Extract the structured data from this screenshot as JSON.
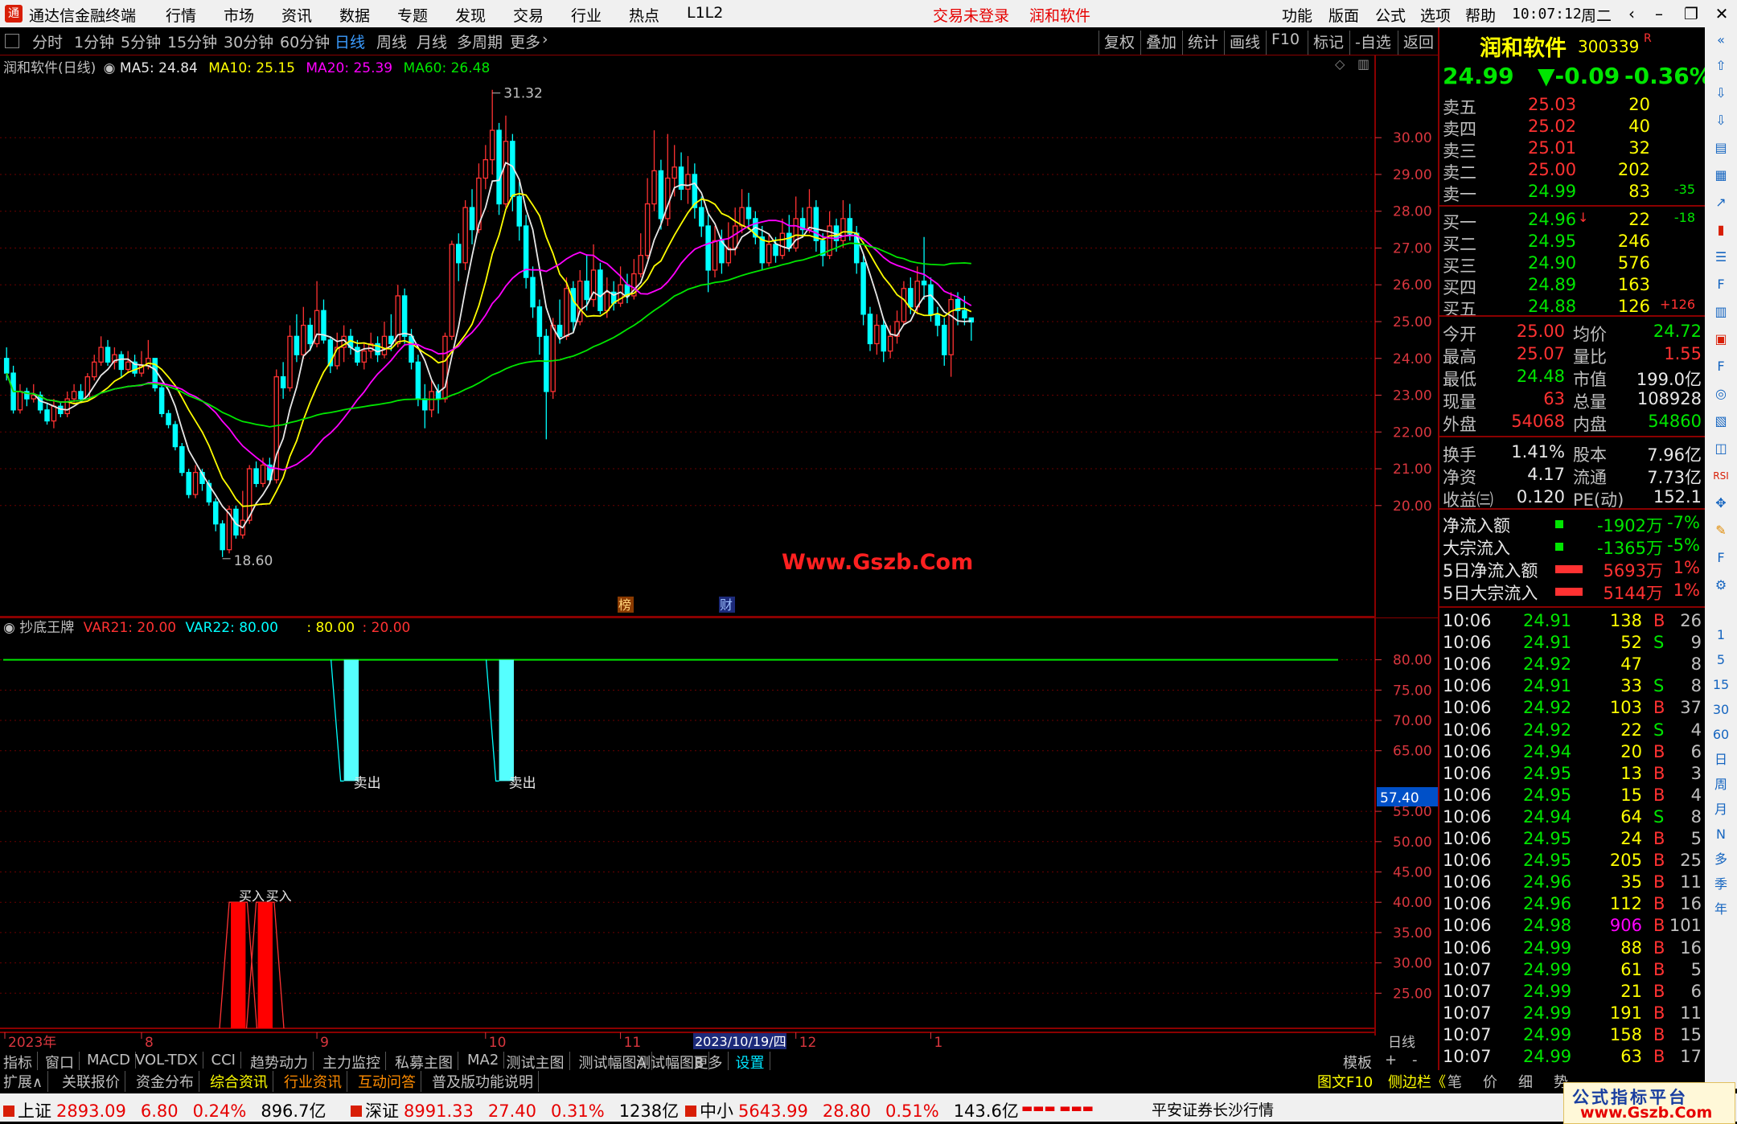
{
  "titlebar": {
    "app_title": "通达信金融终端",
    "menus": [
      "行情",
      "市场",
      "资讯",
      "数据",
      "专题",
      "发现",
      "交易",
      "行业",
      "热点",
      "L1L2"
    ],
    "login_status": "交易未登录",
    "stock_name": "润和软件",
    "right_menus": [
      "功能",
      "版面",
      "公式",
      "选项",
      "帮助"
    ],
    "time": "10:07:12",
    "weekday": "周二"
  },
  "toolbar": {
    "periods": [
      "分时",
      "1分钟",
      "5分钟",
      "15分钟",
      "30分钟",
      "60分钟",
      "日线",
      "周线",
      "月线",
      "多周期",
      "更多"
    ],
    "active": "日线",
    "right_buttons": [
      "复权",
      "叠加",
      "统计",
      "画线",
      "F10",
      "标记",
      "-自选",
      "返回"
    ]
  },
  "chart": {
    "title": "润和软件(日线)",
    "ma": [
      {
        "label": "MA5: 24.84",
        "color": "#e8e8e8"
      },
      {
        "label": "MA10: 25.15",
        "color": "#ffff00"
      },
      {
        "label": "MA20: 25.39",
        "color": "#ff00ff"
      },
      {
        "label": "MA60: 26.48",
        "color": "#00e600"
      }
    ],
    "y_ticks": [
      "30.00",
      "29.00",
      "28.00",
      "27.00",
      "26.00",
      "25.00",
      "24.00",
      "23.00",
      "22.00",
      "21.00",
      "20.00"
    ],
    "high_label": "31.32",
    "low_label": "18.60",
    "watermark": "Www.Gszb.Com",
    "markers": [
      "榜",
      "财"
    ]
  },
  "indicator": {
    "name": "抄底王牌",
    "var21": "VAR21: 20.00",
    "var22": "VAR22: 80.00",
    "lvl1": ": 80.00",
    "lvl2": ": 20.00",
    "y_ticks": [
      "80.00",
      "75.00",
      "70.00",
      "65.00",
      "55.00",
      "50.00",
      "45.00",
      "40.00",
      "35.00",
      "30.00",
      "25.00"
    ],
    "current": "57.40",
    "sell_label": "卖出",
    "buy_label": "买入"
  },
  "x_axis": {
    "labels": [
      "2023年",
      "8",
      "9",
      "10",
      "11",
      "12",
      "1"
    ],
    "cursor_date": "2023/10/19/四",
    "period": "日线"
  },
  "quote": {
    "name": "润和软件",
    "code": "300339",
    "flag": "R",
    "price": "24.99",
    "change": "▼-0.09",
    "pct": "-0.36%",
    "asks": [
      {
        "label": "卖五",
        "price": "25.03",
        "vol": "20",
        "chg": ""
      },
      {
        "label": "卖四",
        "price": "25.02",
        "vol": "40",
        "chg": ""
      },
      {
        "label": "卖三",
        "price": "25.01",
        "vol": "32",
        "chg": ""
      },
      {
        "label": "卖二",
        "price": "25.00",
        "vol": "202",
        "chg": ""
      },
      {
        "label": "卖一",
        "price": "24.99",
        "vol": "83",
        "chg": "-35"
      }
    ],
    "bids": [
      {
        "label": "买一",
        "price": "24.96",
        "arrow": "↓",
        "vol": "22",
        "chg": "-18"
      },
      {
        "label": "买二",
        "price": "24.95",
        "arrow": "",
        "vol": "246",
        "chg": ""
      },
      {
        "label": "买三",
        "price": "24.90",
        "arrow": "",
        "vol": "576",
        "chg": ""
      },
      {
        "label": "买四",
        "price": "24.89",
        "arrow": "",
        "vol": "163",
        "chg": ""
      },
      {
        "label": "买五",
        "price": "24.88",
        "arrow": "",
        "vol": "126",
        "chg": "+126"
      }
    ],
    "stats": [
      {
        "k1": "今开",
        "v1": "25.00",
        "k2": "均价",
        "v2": "24.72",
        "c1": "red",
        "c2": "green"
      },
      {
        "k1": "最高",
        "v1": "25.07",
        "k2": "量比",
        "v2": "1.55",
        "c1": "red",
        "c2": "red"
      },
      {
        "k1": "最低",
        "v1": "24.48",
        "k2": "市值",
        "v2": "199.0亿",
        "c1": "green",
        "c2": "white"
      },
      {
        "k1": "现量",
        "v1": "63",
        "k2": "总量",
        "v2": "108928",
        "c1": "red",
        "c2": "white"
      },
      {
        "k1": "外盘",
        "v1": "54068",
        "k2": "内盘",
        "v2": "54860",
        "c1": "red",
        "c2": "green"
      }
    ],
    "stats2": [
      {
        "k1": "换手",
        "v1": "1.41%",
        "k2": "股本",
        "v2": "7.96亿"
      },
      {
        "k1": "净资",
        "v1": "4.17",
        "k2": "流通",
        "v2": "7.73亿"
      },
      {
        "k1": "收益㈢",
        "v1": "0.120",
        "k2": "PE(动)",
        "v2": "152.1"
      }
    ],
    "flows": [
      {
        "label": "净流入额",
        "val": "-1902万",
        "pct": "-7%",
        "color": "green"
      },
      {
        "label": "大宗流入",
        "val": "-1365万",
        "pct": "-5%",
        "color": "green"
      },
      {
        "label": "5日净流入额",
        "val": "5693万",
        "pct": "1%",
        "color": "red"
      },
      {
        "label": "5日大宗流入",
        "val": "5144万",
        "pct": "1%",
        "color": "red"
      }
    ],
    "ticks": [
      {
        "t": "10:06",
        "p": "24.91",
        "v": "138",
        "s": "B",
        "n": "26"
      },
      {
        "t": "10:06",
        "p": "24.91",
        "v": "52",
        "s": "S",
        "n": "9"
      },
      {
        "t": "10:06",
        "p": "24.92",
        "v": "47",
        "s": "",
        "n": "8"
      },
      {
        "t": "10:06",
        "p": "24.91",
        "v": "33",
        "s": "S",
        "n": "8"
      },
      {
        "t": "10:06",
        "p": "24.92",
        "v": "103",
        "s": "B",
        "n": "37"
      },
      {
        "t": "10:06",
        "p": "24.92",
        "v": "22",
        "s": "S",
        "n": "4"
      },
      {
        "t": "10:06",
        "p": "24.94",
        "v": "20",
        "s": "B",
        "n": "6"
      },
      {
        "t": "10:06",
        "p": "24.95",
        "v": "13",
        "s": "B",
        "n": "3"
      },
      {
        "t": "10:06",
        "p": "24.95",
        "v": "15",
        "s": "B",
        "n": "4"
      },
      {
        "t": "10:06",
        "p": "24.94",
        "v": "64",
        "s": "S",
        "n": "8"
      },
      {
        "t": "10:06",
        "p": "24.95",
        "v": "24",
        "s": "B",
        "n": "5"
      },
      {
        "t": "10:06",
        "p": "24.95",
        "v": "205",
        "s": "B",
        "n": "25"
      },
      {
        "t": "10:06",
        "p": "24.96",
        "v": "35",
        "s": "B",
        "n": "11"
      },
      {
        "t": "10:06",
        "p": "24.96",
        "v": "112",
        "s": "B",
        "n": "16"
      },
      {
        "t": "10:06",
        "p": "24.98",
        "v": "906",
        "s": "B",
        "n": "101"
      },
      {
        "t": "10:06",
        "p": "24.99",
        "v": "88",
        "s": "B",
        "n": "16"
      },
      {
        "t": "10:07",
        "p": "24.99",
        "v": "61",
        "s": "B",
        "n": "5"
      },
      {
        "t": "10:07",
        "p": "24.99",
        "v": "21",
        "s": "B",
        "n": "6"
      },
      {
        "t": "10:07",
        "p": "24.99",
        "v": "191",
        "s": "B",
        "n": "11"
      },
      {
        "t": "10:07",
        "p": "24.99",
        "v": "158",
        "s": "B",
        "n": "15"
      },
      {
        "t": "10:07",
        "p": "24.99",
        "v": "63",
        "s": "B",
        "n": "17"
      }
    ]
  },
  "tabs1": [
    "指标",
    "窗口",
    "MACD",
    "VOL-TDX",
    "CCI",
    "趋势动力",
    "主力监控",
    "私募主图",
    "MA2",
    "测试主图",
    "测试幅图A",
    "测试幅图B",
    "更多",
    "设置"
  ],
  "tabs1_right": [
    "模板",
    "+",
    "-"
  ],
  "tabs2": [
    "扩展∧",
    "关联报价",
    "资金分布",
    "综合资讯",
    "行业资讯",
    "互动问答",
    "普及版功能说明"
  ],
  "tabs2_right": [
    "图文F10",
    "侧边栏《",
    "笔",
    "价",
    "细",
    "势"
  ],
  "iconbar": [
    "1",
    "5",
    "15",
    "30",
    "60",
    "日",
    "周",
    "月",
    "N",
    "多",
    "季",
    "年"
  ],
  "statusbar": {
    "items": [
      {
        "name": "上证",
        "v": "2893.09",
        "c": "6.80",
        "p": "0.24%",
        "a": "896.7亿"
      },
      {
        "name": "深证",
        "v": "8991.33",
        "c": "27.40",
        "p": "0.31%",
        "a": "1238亿"
      },
      {
        "name": "中小",
        "v": "5643.99",
        "c": "28.80",
        "p": "0.51%",
        "a": "143.6亿"
      }
    ],
    "broker": "平安证券长沙行情",
    "brand": "公式指标平台",
    "brand_url": "www.Gszb.Com"
  },
  "colors": {
    "up": "#ff3232",
    "down": "#00ffff",
    "ma5": "#e8e8e8",
    "ma10": "#ffff00",
    "ma20": "#ff00ff",
    "ma60": "#00e600"
  },
  "chart_data": {
    "type": "candlestick",
    "y_range": [
      18.4,
      31.6
    ],
    "candles": [
      [
        24.0,
        23.6,
        24.3,
        23.4
      ],
      [
        23.6,
        22.6,
        23.8,
        22.5
      ],
      [
        22.6,
        23.1,
        23.3,
        22.5
      ],
      [
        23.1,
        22.9,
        23.2,
        22.7
      ],
      [
        22.9,
        23.0,
        23.3,
        22.8
      ],
      [
        23.0,
        22.6,
        23.1,
        22.5
      ],
      [
        22.6,
        22.3,
        22.8,
        22.2
      ],
      [
        22.3,
        22.7,
        22.9,
        22.1
      ],
      [
        22.7,
        22.5,
        22.8,
        22.4
      ],
      [
        22.5,
        22.9,
        23.1,
        22.4
      ],
      [
        22.9,
        23.1,
        23.3,
        22.8
      ],
      [
        23.1,
        22.9,
        23.3,
        22.8
      ],
      [
        22.9,
        23.5,
        23.6,
        22.9
      ],
      [
        23.5,
        23.9,
        24.1,
        23.4
      ],
      [
        23.9,
        24.3,
        24.6,
        23.8
      ],
      [
        24.3,
        23.9,
        24.5,
        23.8
      ],
      [
        23.9,
        24.1,
        24.3,
        23.7
      ],
      [
        24.1,
        23.7,
        24.2,
        23.5
      ],
      [
        23.7,
        23.9,
        24.2,
        23.6
      ],
      [
        23.9,
        23.6,
        24.1,
        23.5
      ],
      [
        23.6,
        23.8,
        24.2,
        23.5
      ],
      [
        23.8,
        24.0,
        24.5,
        23.7
      ],
      [
        24.0,
        23.2,
        24.0,
        23.1
      ],
      [
        23.2,
        22.5,
        23.3,
        22.4
      ],
      [
        22.5,
        22.2,
        22.6,
        22.1
      ],
      [
        22.2,
        21.6,
        22.3,
        21.5
      ],
      [
        21.6,
        20.9,
        21.7,
        20.8
      ],
      [
        20.9,
        20.3,
        21.0,
        20.2
      ],
      [
        20.3,
        20.9,
        21.1,
        20.2
      ],
      [
        20.9,
        20.6,
        21.0,
        20.4
      ],
      [
        20.6,
        20.1,
        20.7,
        20.0
      ],
      [
        20.1,
        19.5,
        20.2,
        19.3
      ],
      [
        19.5,
        18.8,
        19.6,
        18.6
      ],
      [
        18.8,
        19.9,
        20.0,
        18.7
      ],
      [
        19.9,
        19.2,
        20.0,
        19.1
      ],
      [
        19.2,
        19.6,
        20.4,
        19.1
      ],
      [
        19.6,
        21.0,
        21.1,
        19.5
      ],
      [
        21.0,
        20.6,
        21.2,
        20.5
      ],
      [
        20.6,
        21.1,
        21.3,
        20.5
      ],
      [
        21.1,
        20.7,
        21.3,
        20.6
      ],
      [
        20.7,
        23.5,
        23.7,
        20.6
      ],
      [
        23.5,
        23.2,
        23.9,
        22.9
      ],
      [
        23.2,
        24.6,
        24.9,
        23.1
      ],
      [
        24.6,
        24.1,
        25.2,
        23.9
      ],
      [
        24.1,
        24.9,
        25.4,
        24.0
      ],
      [
        24.9,
        24.4,
        25.1,
        24.2
      ],
      [
        24.4,
        25.3,
        26.1,
        24.3
      ],
      [
        25.3,
        24.5,
        25.6,
        24.4
      ],
      [
        24.5,
        23.8,
        24.6,
        23.6
      ],
      [
        23.8,
        24.3,
        24.7,
        23.7
      ],
      [
        24.3,
        24.6,
        24.9,
        23.9
      ],
      [
        24.6,
        24.3,
        24.8,
        24.1
      ],
      [
        24.3,
        23.9,
        24.5,
        23.8
      ],
      [
        23.9,
        24.2,
        24.4,
        23.7
      ],
      [
        24.2,
        24.4,
        24.7,
        24.0
      ],
      [
        24.4,
        24.1,
        24.6,
        23.9
      ],
      [
        24.1,
        24.6,
        25.0,
        24.0
      ],
      [
        24.6,
        24.4,
        25.2,
        24.2
      ],
      [
        24.4,
        25.7,
        26.0,
        24.3
      ],
      [
        25.7,
        24.6,
        25.9,
        24.4
      ],
      [
        24.6,
        23.9,
        24.8,
        23.7
      ],
      [
        23.9,
        22.9,
        24.1,
        22.7
      ],
      [
        22.9,
        22.6,
        23.3,
        22.1
      ],
      [
        22.6,
        23.1,
        23.4,
        22.4
      ],
      [
        23.1,
        22.9,
        23.3,
        22.5
      ],
      [
        22.9,
        24.6,
        24.7,
        22.8
      ],
      [
        24.6,
        27.1,
        27.2,
        24.5
      ],
      [
        27.1,
        26.6,
        27.4,
        26.1
      ],
      [
        26.6,
        28.1,
        28.3,
        26.4
      ],
      [
        28.1,
        27.5,
        28.6,
        27.1
      ],
      [
        27.5,
        28.9,
        29.3,
        27.4
      ],
      [
        28.9,
        29.4,
        29.8,
        28.6
      ],
      [
        29.4,
        30.2,
        31.3,
        29.0
      ],
      [
        30.2,
        28.2,
        30.4,
        27.9
      ],
      [
        28.2,
        29.9,
        30.6,
        28.1
      ],
      [
        29.9,
        28.4,
        30.1,
        28.0
      ],
      [
        28.4,
        27.6,
        28.8,
        27.2
      ],
      [
        27.6,
        26.2,
        27.9,
        25.9
      ],
      [
        26.2,
        25.4,
        26.5,
        25.1
      ],
      [
        25.4,
        24.6,
        25.6,
        24.1
      ],
      [
        24.6,
        23.1,
        24.8,
        21.8
      ],
      [
        23.1,
        24.9,
        25.1,
        22.9
      ],
      [
        24.9,
        24.6,
        25.6,
        24.4
      ],
      [
        24.6,
        25.9,
        26.2,
        24.5
      ],
      [
        25.9,
        25.0,
        26.1,
        24.7
      ],
      [
        25.0,
        26.1,
        26.4,
        24.9
      ],
      [
        26.1,
        25.6,
        26.8,
        25.3
      ],
      [
        25.6,
        26.4,
        27.1,
        25.4
      ],
      [
        26.4,
        25.3,
        26.6,
        25.2
      ],
      [
        25.3,
        25.8,
        26.2,
        25.1
      ],
      [
        25.8,
        25.5,
        26.1,
        25.3
      ],
      [
        25.5,
        26.0,
        26.5,
        25.4
      ],
      [
        26.0,
        25.7,
        26.3,
        25.5
      ],
      [
        25.7,
        26.3,
        26.7,
        25.6
      ],
      [
        26.3,
        26.8,
        27.4,
        26.2
      ],
      [
        26.8,
        28.2,
        28.9,
        26.7
      ],
      [
        28.2,
        29.1,
        30.2,
        28.0
      ],
      [
        29.1,
        27.8,
        29.4,
        27.5
      ],
      [
        27.8,
        28.9,
        30.1,
        27.6
      ],
      [
        28.9,
        29.2,
        29.8,
        28.4
      ],
      [
        29.2,
        28.6,
        29.6,
        28.3
      ],
      [
        28.6,
        29.0,
        29.5,
        28.2
      ],
      [
        29.0,
        28.1,
        29.3,
        27.8
      ],
      [
        28.1,
        27.6,
        28.4,
        27.3
      ],
      [
        27.6,
        26.4,
        27.9,
        25.8
      ],
      [
        26.4,
        27.2,
        27.6,
        26.2
      ],
      [
        27.2,
        26.6,
        27.5,
        26.3
      ],
      [
        26.6,
        27.0,
        27.7,
        26.5
      ],
      [
        27.0,
        27.6,
        28.1,
        26.8
      ],
      [
        27.6,
        28.1,
        28.6,
        27.4
      ],
      [
        28.1,
        27.8,
        28.5,
        27.5
      ],
      [
        27.8,
        27.3,
        28.0,
        27.1
      ],
      [
        27.3,
        26.6,
        27.6,
        26.4
      ],
      [
        26.6,
        27.1,
        27.4,
        26.5
      ],
      [
        27.1,
        26.8,
        27.3,
        26.6
      ],
      [
        26.8,
        27.4,
        27.8,
        26.7
      ],
      [
        27.4,
        27.0,
        27.9,
        26.9
      ],
      [
        27.0,
        27.8,
        28.4,
        26.9
      ],
      [
        27.8,
        27.5,
        28.1,
        27.3
      ],
      [
        27.5,
        28.1,
        28.6,
        27.4
      ],
      [
        28.1,
        27.2,
        28.3,
        26.9
      ],
      [
        27.2,
        26.8,
        27.4,
        26.5
      ],
      [
        26.8,
        27.6,
        28.0,
        26.7
      ],
      [
        27.6,
        27.2,
        27.8,
        26.9
      ],
      [
        27.2,
        27.8,
        28.3,
        27.0
      ],
      [
        27.8,
        27.4,
        28.2,
        27.2
      ],
      [
        27.4,
        26.6,
        27.6,
        26.3
      ],
      [
        26.6,
        25.2,
        26.8,
        24.9
      ],
      [
        25.2,
        24.4,
        25.4,
        24.2
      ],
      [
        24.4,
        24.9,
        25.2,
        24.1
      ],
      [
        24.9,
        24.2,
        25.1,
        23.9
      ],
      [
        24.2,
        24.6,
        24.9,
        24.0
      ],
      [
        24.6,
        25.0,
        25.3,
        24.4
      ],
      [
        25.0,
        25.9,
        26.1,
        24.9
      ],
      [
        25.9,
        25.4,
        26.2,
        25.2
      ],
      [
        25.4,
        26.1,
        26.5,
        25.2
      ],
      [
        26.1,
        26.0,
        27.3,
        25.6
      ],
      [
        26.0,
        25.2,
        26.2,
        25.0
      ],
      [
        25.2,
        24.9,
        25.4,
        24.6
      ],
      [
        24.9,
        24.1,
        25.1,
        23.8
      ],
      [
        24.1,
        25.6,
        25.8,
        23.5
      ],
      [
        25.6,
        25.3,
        25.8,
        24.9
      ],
      [
        25.3,
        25.1,
        25.7,
        24.9
      ],
      [
        25.1,
        24.99,
        25.07,
        24.48
      ]
    ],
    "indicator_bars": {
      "buy": [
        {
          "from_index": 33,
          "to_index": 34,
          "value": 40
        },
        {
          "from_index": 37,
          "to_index": 38,
          "value": 40
        }
      ],
      "sell": [
        {
          "from_index": 50,
          "to_index": 51,
          "value": 60
        },
        {
          "from_index": 73,
          "to_index": 74,
          "value": 60
        }
      ]
    },
    "indicator_range": [
      20,
      83
    ]
  }
}
